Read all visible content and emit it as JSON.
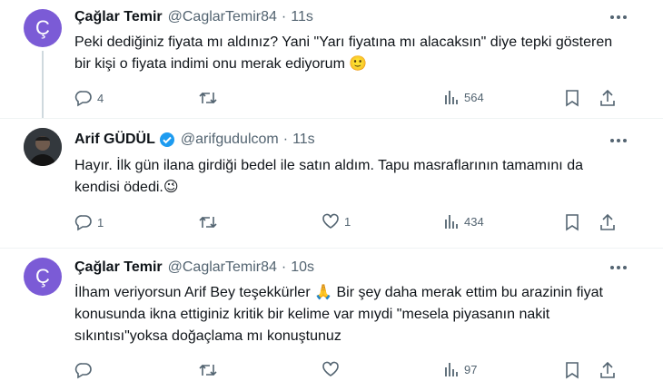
{
  "tweets": [
    {
      "name": "Çağlar Temir",
      "handle": "@CaglarTemir84",
      "time": "11s",
      "avatar_letter": "Ç",
      "avatar_color": "#7b5bd6",
      "verified": false,
      "text": "Peki dediğiniz fiyata mı aldınız? Yani \"Yarı fiyatına mı alacaksın\" diye tepki gösteren bir kişi o fiyata indimi onu merak ediyorum 🙂",
      "replies": "4",
      "retweets": "",
      "likes": "",
      "views": "564"
    },
    {
      "name": "Arif GÜDÜL",
      "handle": "@arifgudulcom",
      "time": "11s",
      "verified": true,
      "text": "Hayır. İlk gün ilana girdiği bedel ile satın aldım. Tapu masraflarının tamamını da  kendisi ödedi.😉",
      "replies": "1",
      "retweets": "",
      "likes": "1",
      "views": "434"
    },
    {
      "name": "Çağlar Temir",
      "handle": "@CaglarTemir84",
      "time": "10s",
      "avatar_letter": "Ç",
      "avatar_color": "#7b5bd6",
      "verified": false,
      "text": "İlham veriyorsun Arif Bey teşekkürler 🙏 Bir şey daha merak ettim bu arazinin fiyat konusunda ikna ettiginiz kritik bir kelime var mıydi \"mesela piyasanın nakit sıkıntısı\"yoksa doğaçlama mı konuştunuz",
      "replies": "",
      "retweets": "",
      "likes": "",
      "views": "97"
    }
  ],
  "separator": "·",
  "colors": {
    "verified": "#1d9bf0",
    "muted": "#536471",
    "text": "#0f1419"
  }
}
